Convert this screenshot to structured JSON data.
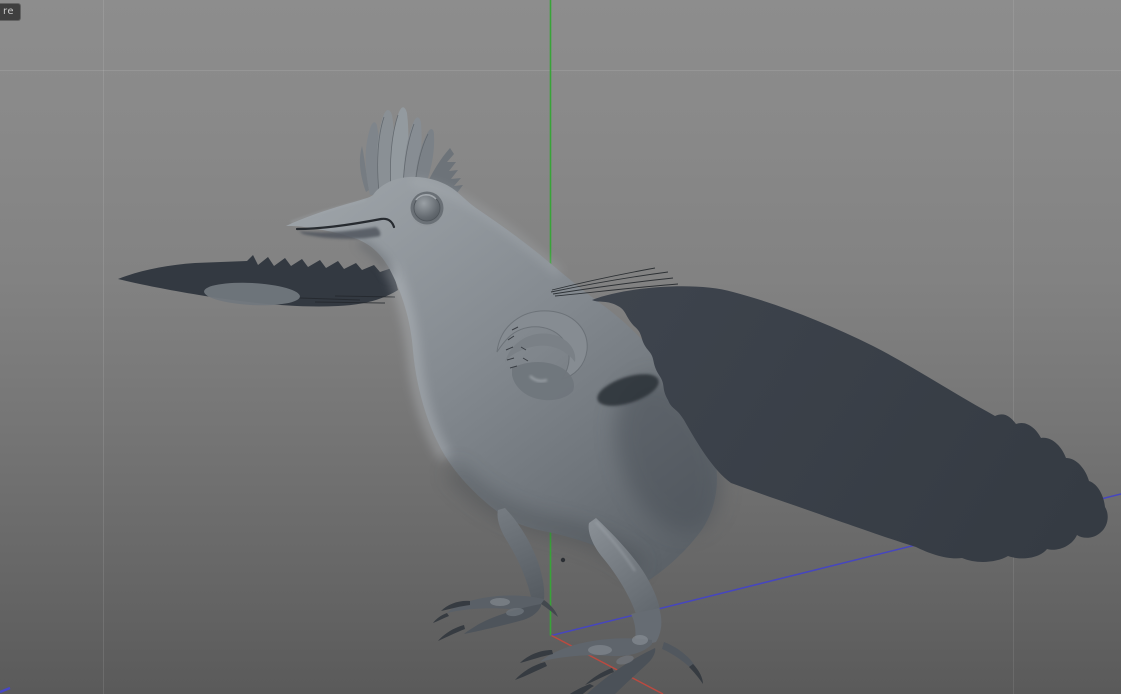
{
  "window": {
    "tooltip_fragment": "re"
  },
  "viewport": {
    "background": {
      "top": "#8d8d8d",
      "bottom": "#5a5a5a"
    },
    "grid": {
      "line_color": "rgba(255,255,255,0.10)"
    },
    "axes": {
      "y": {
        "name": "Y axis (vertical)",
        "color": "#38a438"
      },
      "z": {
        "name": "Z axis (to upper right)",
        "color": "#4646c0"
      },
      "x": {
        "name": "X axis (to lower right)",
        "color": "#bb4a40"
      }
    },
    "gizmo_color": "#4747c8",
    "model": {
      "description": "untextured gray 3D bird model with head crest, spread dark wings and clawed feet",
      "body_color": "#82888e",
      "right_wing_color": "#3a4048",
      "left_wing_color": "#333941",
      "wing_patch_color": "#71777d",
      "claw_color": "#363b41"
    }
  }
}
